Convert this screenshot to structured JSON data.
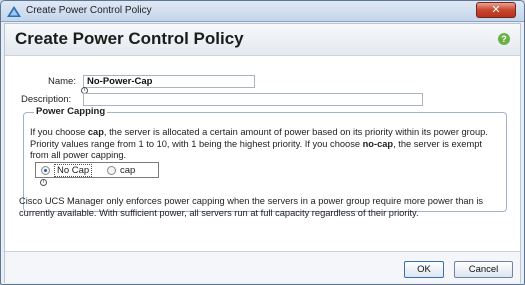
{
  "window": {
    "title": "Create Power Control Policy",
    "close_label": "✕"
  },
  "header": {
    "title": "Create Power Control Policy",
    "help_icon": "help-icon",
    "help_glyph": "?"
  },
  "form": {
    "name_label": "Name:",
    "name_value": "No-Power-Cap",
    "description_label": "Description:",
    "description_value": ""
  },
  "power_capping": {
    "title": "Power Capping",
    "description_parts": [
      "If you choose ",
      "cap",
      ", the server is allocated a certain amount of power based on its priority within its power group. Priority values range from 1 to 10, with 1 being the highest priority. If you choose ",
      "no-cap",
      ", the server is exempt from all power capping."
    ],
    "options": [
      {
        "label": "No Cap",
        "selected": true
      },
      {
        "label": "cap",
        "selected": false
      }
    ]
  },
  "note": "Cisco UCS Manager only enforces power capping when the servers in a power group require more power than is currently available. With sufficient power, all servers run at full capacity regardless of their priority.",
  "footer": {
    "ok_label": "OK",
    "cancel_label": "Cancel"
  },
  "colors": {
    "accent": "#2d5fa8",
    "help_icon": "#6ab046",
    "close_button": "#c8452d"
  }
}
